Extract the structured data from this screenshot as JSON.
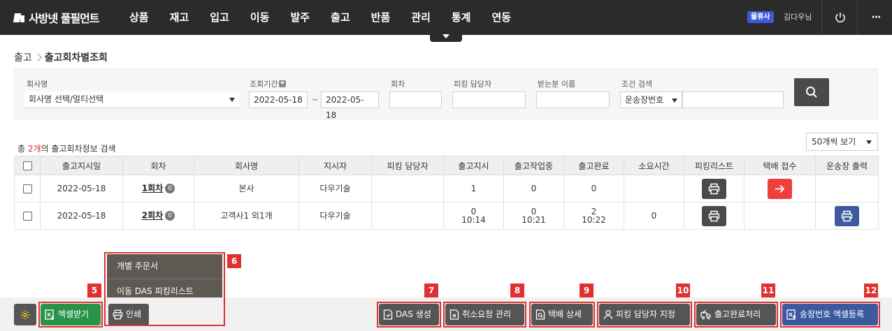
{
  "header": {
    "logo_text": "사방넷 풀필먼트",
    "nav": [
      "상품",
      "재고",
      "입고",
      "이동",
      "발주",
      "출고",
      "반품",
      "관리",
      "통계",
      "연동"
    ],
    "company_badge": "물류사",
    "user_name": "김다우님"
  },
  "breadcrumb": {
    "parent": "출고",
    "current": "출고회차별조회"
  },
  "filters": {
    "company_label": "회사명",
    "company_value": "회사명 선택/멀티선택",
    "period_label": "조회기간",
    "date_from": "2022-05-18",
    "date_sep": "~",
    "date_to": "2022-05-18",
    "round_label": "회차",
    "picker_label": "피킹 담당자",
    "receiver_label": "받는분 이름",
    "cond_label": "조건 검색",
    "cond_value": "운송장번호"
  },
  "summary": {
    "prefix": "총 ",
    "count": "2개",
    "suffix": "의 출고회차정보 검색"
  },
  "page_size": "50개씩 보기",
  "table": {
    "headers": [
      "출고지시일",
      "회차",
      "회사명",
      "지시자",
      "피킹 담당자",
      "출고지시",
      "출고작업중",
      "출고완료",
      "소요시간",
      "피킹리스트",
      "택배 접수",
      "운송장 출력"
    ],
    "rows": [
      {
        "date": "2022-05-18",
        "round": "1회차",
        "badge": "0",
        "company": "본사",
        "instructor": "다우기술",
        "picker": "",
        "ordered": "1",
        "ordered_time": "",
        "working": "0",
        "working_time": "",
        "done": "0",
        "done_time": "",
        "elapsed": ""
      },
      {
        "date": "2022-05-18",
        "round": "2회차",
        "badge": "0",
        "company": "고객사1 외1개",
        "instructor": "다우기술",
        "picker": "",
        "ordered": "0",
        "ordered_time": "10:14",
        "working": "0",
        "working_time": "10:21",
        "done": "2",
        "done_time": "10:22",
        "elapsed": "0"
      }
    ]
  },
  "popup_menu": [
    "개별 주문서",
    "이동 DAS 피킹리스트"
  ],
  "bottom": {
    "excel": "엑셀받기",
    "print": "인쇄",
    "das": "DAS 생성",
    "cancel_req": "취소요청 관리",
    "delivery_detail": "택배 상세",
    "assign_picker": "피킹 담당자 지정",
    "complete": "출고완료처리",
    "invoice_excel": "송장번호 엑셀등록"
  },
  "callouts": [
    "5",
    "6",
    "7",
    "8",
    "9",
    "10",
    "11",
    "12"
  ],
  "colors": {
    "topbar": "#2b2b2b",
    "accent_red": "#e03131",
    "excel_green": "#2b9348",
    "invoice_blue": "#3d5a9f",
    "company_badge": "#3b5bdb"
  }
}
